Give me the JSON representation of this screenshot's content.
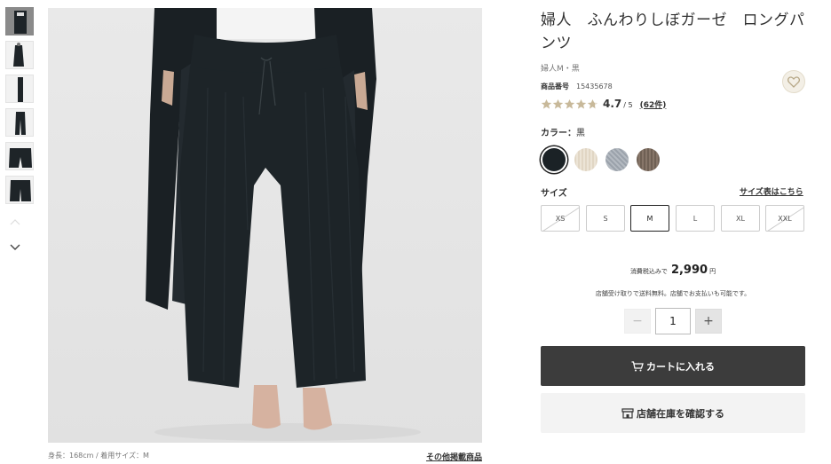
{
  "product": {
    "title": "婦人　ふんわりしぼガーゼ　ロングパンツ",
    "subcategory": "婦人M・黒",
    "product_number_label": "商品番号",
    "product_number": "15435678",
    "rating": "4.7",
    "rating_max": "/ 5",
    "rating_value": 4.7,
    "review_count": "(62件)"
  },
  "gallery": {
    "caption": "身長：168cm / 着用サイズ：M",
    "other_items_link": "その他掲載商品"
  },
  "color": {
    "label": "カラー：",
    "selected": "黒",
    "swatches": [
      {
        "name": "black",
        "hex": "#1b2226"
      },
      {
        "name": "ivory",
        "hex": "#e6dccc"
      },
      {
        "name": "gray",
        "hex": "#a4abb3"
      },
      {
        "name": "brown",
        "hex": "#7b6b5e"
      }
    ]
  },
  "size": {
    "label": "サイズ",
    "chart_link": "サイズ表はこちら",
    "options": [
      "XS",
      "S",
      "M",
      "L",
      "XL",
      "XXL"
    ],
    "selected": "M",
    "unavailable": [
      "XS",
      "XXL"
    ]
  },
  "price": {
    "tax_label": "消費税込みで",
    "amount": "2,990",
    "unit": "円",
    "shipping_note": "店舗受け取りで送料無料。店舗でお支払いも可能です。"
  },
  "quantity": {
    "minus": "−",
    "value": "1",
    "plus": "+"
  },
  "buttons": {
    "cart": "カートに入れる",
    "store_stock": "店舗在庫を確認する"
  },
  "icons": {
    "favorite": "heart-icon",
    "cart": "cart-icon",
    "store": "store-icon",
    "nav_up": "chevron-up-icon",
    "nav_down": "chevron-down-icon"
  },
  "colors": {
    "primary_button": "#3c3c3c",
    "secondary_button": "#f3f3f3",
    "star": "#c8b99a"
  }
}
